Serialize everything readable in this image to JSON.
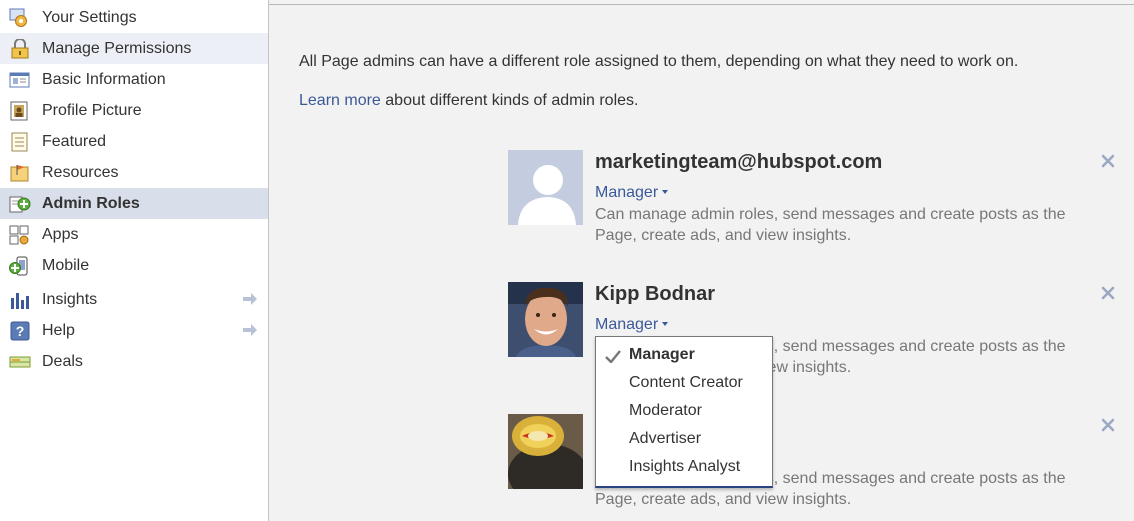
{
  "sidebar": {
    "items": [
      {
        "label": "Your Settings",
        "icon": "settings-gear-icon"
      },
      {
        "label": "Manage Permissions",
        "icon": "lock-icon"
      },
      {
        "label": "Basic Information",
        "icon": "id-card-icon"
      },
      {
        "label": "Profile Picture",
        "icon": "profile-picture-icon"
      },
      {
        "label": "Featured",
        "icon": "featured-list-icon"
      },
      {
        "label": "Resources",
        "icon": "resources-flag-icon"
      },
      {
        "label": "Admin Roles",
        "icon": "admin-roles-icon"
      },
      {
        "label": "Apps",
        "icon": "apps-icon"
      },
      {
        "label": "Mobile",
        "icon": "mobile-icon"
      },
      {
        "label": "Insights",
        "icon": "insights-chart-icon"
      },
      {
        "label": "Help",
        "icon": "help-question-icon"
      },
      {
        "label": "Deals",
        "icon": "deals-ticket-icon"
      }
    ],
    "selected_index": 6,
    "hover_index": 1
  },
  "main": {
    "intro_text": "All Page admins can have a different role assigned to them, depending on what they need to work on.",
    "learn_more_link": "Learn more",
    "learn_more_suffix": " about different kinds of admin roles."
  },
  "admins": [
    {
      "name": "marketingteam@hubspot.com",
      "role": "Manager",
      "description": "Can manage admin roles, send messages and create posts as the Page, create ads, and view insights."
    },
    {
      "name": "Kipp Bodnar",
      "role": "Manager",
      "description": "Can manage admin roles, send messages and create posts as the Page, create ads, and view insights."
    },
    {
      "name": "",
      "role": "",
      "description": "Can manage admin roles, send messages and create posts as the Page, create ads, and view insights."
    }
  ],
  "role_menu": {
    "options": [
      "Manager",
      "Content Creator",
      "Moderator",
      "Advertiser",
      "Insights Analyst"
    ],
    "checked": "Manager"
  },
  "colors": {
    "link": "#3b5998",
    "selected_bg": "#d8dfea",
    "main_bg": "#f2f2f2"
  }
}
